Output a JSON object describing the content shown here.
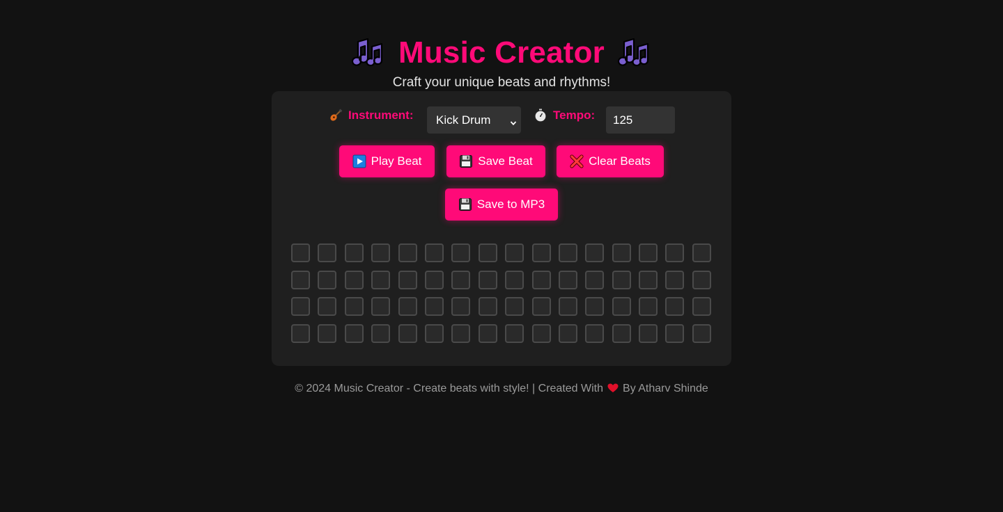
{
  "header": {
    "title": "Music Creator",
    "subtitle": "Craft your unique beats and rhythms!",
    "left_icon": "musical-notes-icon",
    "right_icon": "musical-notes-icon"
  },
  "controls": {
    "instrument_label": "Instrument:",
    "instrument_icon": "guitar-icon",
    "instrument_value": "Kick Drum",
    "tempo_label": "Tempo:",
    "tempo_icon": "stopwatch-icon",
    "tempo_value": "125"
  },
  "buttons": {
    "play": {
      "label": "Play Beat",
      "icon": "play-icon"
    },
    "save": {
      "label": "Save Beat",
      "icon": "floppy-disk-icon"
    },
    "clear": {
      "label": "Clear Beats",
      "icon": "cross-mark-icon"
    },
    "mp3": {
      "label": "Save to MP3",
      "icon": "floppy-disk-icon"
    }
  },
  "beat_grid": {
    "rows": 4,
    "columns": 16,
    "active_cells": []
  },
  "footer": {
    "text_before": "© 2024 Music Creator - Create beats with style! | Created With",
    "heart_icon": "heart-icon",
    "text_after": "By Atharv Shinde"
  },
  "colors": {
    "background": "#121212",
    "panel": "#1f1f1f",
    "accent": "#ff0a78",
    "input_bg": "#333333",
    "cell_bg": "#2a2a2a",
    "cell_border": "#4a4a4a",
    "footer_text": "#9a9a9a"
  }
}
